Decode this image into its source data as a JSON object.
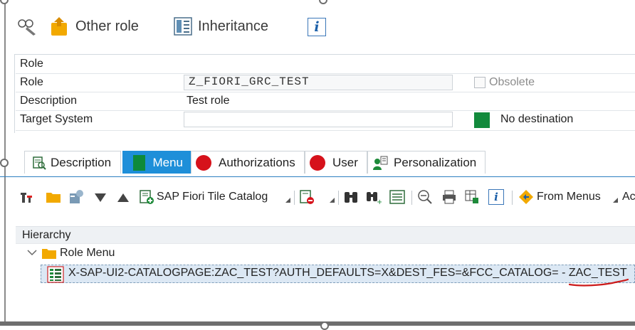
{
  "toolbar": {
    "other_role": "Other role",
    "inheritance": "Inheritance",
    "info": "i"
  },
  "role_panel": {
    "section_title": "Role",
    "role_label": "Role",
    "role_value": "Z_FIORI_GRC_TEST",
    "obsolete_label": "Obsolete",
    "description_label": "Description",
    "description_value": "Test role",
    "target_system_label": "Target System",
    "target_system_value": "",
    "destination_status": "No destination"
  },
  "tabs": [
    {
      "label": "Description"
    },
    {
      "label": "Menu",
      "active": true
    },
    {
      "label": "Authorizations"
    },
    {
      "label": "User"
    },
    {
      "label": "Personalization"
    }
  ],
  "menu_toolbar": {
    "sap_fiori_tile_catalog": "SAP Fiori Tile Catalog",
    "from_menus": "From Menus",
    "truncated": "Ac",
    "info": "i"
  },
  "hierarchy": {
    "header": "Hierarchy",
    "root": "Role Menu",
    "item": "X-SAP-UI2-CATALOGPAGE:ZAC_TEST?AUTH_DEFAULTS=X&DEST_FES=&FCC_CATALOG= - ZAC_TEST"
  },
  "colors": {
    "accent_blue": "#1e8fd9",
    "status_green": "#0e8a3a",
    "status_red": "#d6121b",
    "annotation_red": "#cc1a1a"
  }
}
